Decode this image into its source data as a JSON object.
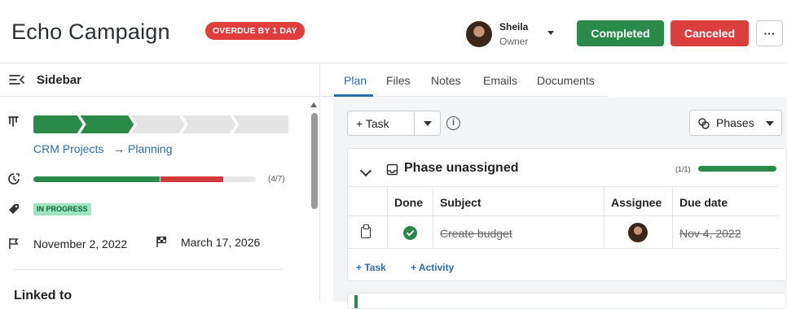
{
  "header": {
    "title": "Echo Campaign",
    "overdue_badge": "OVERDUE BY 1 DAY",
    "owner": {
      "name": "Sheila",
      "role": "Owner"
    },
    "completed_label": "Completed",
    "canceled_label": "Canceled",
    "more_label": "···"
  },
  "sidebar": {
    "title": "Sidebar",
    "pipeline": {
      "stages_total": 5,
      "stages_done": 2
    },
    "crm_path": {
      "project": "CRM Projects",
      "arrow": "→",
      "stage": "Planning"
    },
    "task_progress": {
      "count_label": "(4/7)",
      "done_fraction": 0.567,
      "late_fraction": 0.282
    },
    "status": "IN PROGRESS",
    "start_date": "November 2, 2022",
    "end_date": "March 17, 2026",
    "linked_to": "Linked to"
  },
  "main": {
    "tabs": [
      {
        "label": "Plan",
        "active": true
      },
      {
        "label": "Files"
      },
      {
        "label": "Notes"
      },
      {
        "label": "Emails"
      },
      {
        "label": "Documents"
      }
    ],
    "toolbar": {
      "add_task_label": "+  Task",
      "phases_label": "Phases"
    },
    "phase": {
      "title": "Phase unassigned",
      "count": "(1/1)",
      "progress": 1,
      "columns": [
        "Done",
        "Subject",
        "Assignee",
        "Due date"
      ],
      "rows": [
        {
          "done": true,
          "subject": "Create budget",
          "due_date": "Nov 4, 2022"
        }
      ],
      "add_task": "+  Task",
      "add_activity": "+  Activity"
    }
  },
  "colors": {
    "success": "#2a8a49",
    "danger": "#dc3e3e",
    "link": "#2b6cb0",
    "status_bg": "#9de4bf"
  },
  "icons": {
    "sidebar_toggle": "menu-collapse-icon",
    "pipeline": "pipeline-icon",
    "progress": "timer-icon",
    "status": "tag-icon",
    "start_date": "flag-icon",
    "end_date": "finish-flag-icon",
    "info": "info-icon",
    "phases": "phases-icon",
    "phase_heading": "inbox-icon",
    "task_row": "clipboard-icon",
    "done": "check-circle-icon"
  }
}
